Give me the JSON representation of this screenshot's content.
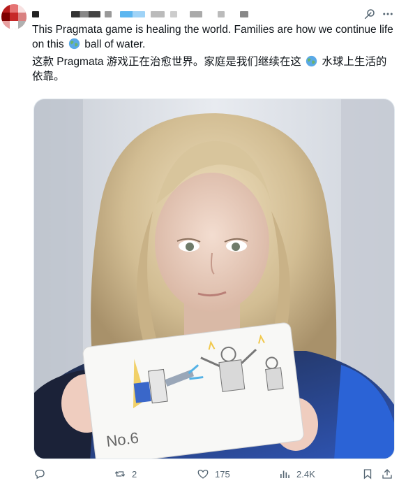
{
  "tweet": {
    "text_en_before": "This Pragmata game is healing the world. Families are how we continue life on this ",
    "text_en_after": " ball of water.",
    "text_zh_before": "这款 Pragmata 游戏正在治愈世界。家庭是我们继续在这 ",
    "text_zh_after": " 水球上生活的依靠。"
  },
  "media": {
    "drawing_label": "No.6"
  },
  "actions": {
    "reply_count": "",
    "repost_count": "2",
    "like_count": "175",
    "views_count": "2.4K"
  },
  "icons": [
    "avatar",
    "grok-icon",
    "more-icon",
    "globe-emoji-icon",
    "reply-icon",
    "repost-icon",
    "like-icon",
    "views-icon",
    "bookmark-icon",
    "share-icon"
  ],
  "colors": {
    "text": "#0f1419",
    "muted": "#536471",
    "accent": "#1d9bf0"
  }
}
